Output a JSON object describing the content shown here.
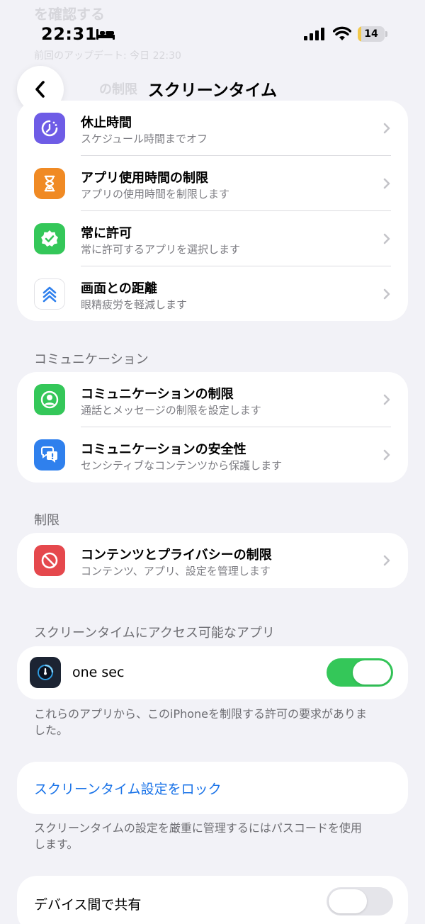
{
  "status_bar": {
    "time": "22:31",
    "battery_percent": "14",
    "battery_level": 0.14,
    "icons": [
      "bed-icon",
      "cellular-signal-icon",
      "wifi-icon",
      "battery-icon"
    ]
  },
  "background_scrolled": {
    "line1": "を確認する",
    "line2": "前回のアップデート: 今日 22:30",
    "line3": "の制限"
  },
  "nav": {
    "title": "スクリーンタイム",
    "back_icon": "chevron-left-icon"
  },
  "limits_group": {
    "items": [
      {
        "title": "休止時間",
        "subtitle": "スケジュール時間までオフ",
        "icon": "downtime-icon",
        "color": "#6e5ce6"
      },
      {
        "title": "アプリ使用時間の制限",
        "subtitle": "アプリの使用時間を制限します",
        "icon": "hourglass-icon",
        "color": "#f08a24"
      },
      {
        "title": "常に許可",
        "subtitle": "常に許可するアプリを選択します",
        "icon": "checkmark-badge-icon",
        "color": "#34c759"
      },
      {
        "title": "画面との距離",
        "subtitle": "眼精疲労を軽減します",
        "icon": "chevrons-up-icon",
        "color": "#ffffff"
      }
    ]
  },
  "communication_section": {
    "header": "コミュニケーション",
    "items": [
      {
        "title": "コミュニケーションの制限",
        "subtitle": "通話とメッセージの制限を設定します",
        "icon": "person-circle-icon",
        "color": "#34c759"
      },
      {
        "title": "コミュニケーションの安全性",
        "subtitle": "センシティブなコンテンツから保護します",
        "icon": "chat-bubbles-icon",
        "color": "#2f80ed"
      }
    ]
  },
  "restrictions_section": {
    "header": "制限",
    "items": [
      {
        "title": "コンテンツとプライバシーの制限",
        "subtitle": "コンテンツ、アプリ、設定を管理します",
        "icon": "prohibited-icon",
        "color": "#e5484d"
      }
    ]
  },
  "access_section": {
    "header": "スクリーンタイムにアクセス可能なアプリ",
    "app_name": "one sec",
    "app_icon": "one-sec-icon",
    "toggle_on": true,
    "footer": "これらのアプリから、このiPhoneを制限する許可の要求がありました。"
  },
  "lock_section": {
    "link": "スクリーンタイム設定をロック",
    "footer": "スクリーンタイムの設定を厳重に管理するにはパスコードを使用します。"
  },
  "share_section": {
    "label": "デバイス間で共有",
    "toggle_on": false
  },
  "colors": {
    "background": "#f2f2f7",
    "accent_blue": "#1a73e8",
    "toggle_on": "#34c759",
    "toggle_off": "#e5e5ea"
  }
}
